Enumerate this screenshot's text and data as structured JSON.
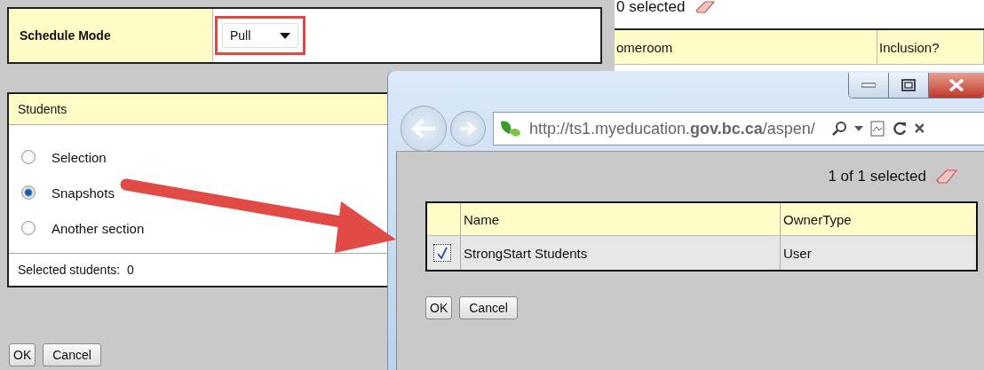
{
  "schedule_mode": {
    "label": "Schedule Mode",
    "value": "Pull",
    "highlighted": true
  },
  "students_panel": {
    "title": "Students",
    "options": [
      {
        "label": "Selection",
        "selected": false
      },
      {
        "label": "Snapshots",
        "selected": true
      },
      {
        "label": "Another section",
        "selected": false
      }
    ],
    "footer": {
      "label": "Selected students:",
      "value": "0"
    }
  },
  "buttons": [
    "OK",
    "Cancel"
  ],
  "background_list": {
    "count": "0 selected",
    "columns": [
      "omeroom",
      "Inclusion?"
    ]
  },
  "popup": {
    "url": "http://ts1.myeducation.**gov.bc.ca**/aspen/",
    "selection_count": "1 of 1 selected",
    "table": {
      "columns": [
        "Name",
        "OwnerType"
      ],
      "rows": [
        {
          "checked": true,
          "cells": [
            "StrongStart Students",
            "User"
          ]
        }
      ]
    },
    "buttons": [
      "OK",
      "Cancel"
    ]
  }
}
